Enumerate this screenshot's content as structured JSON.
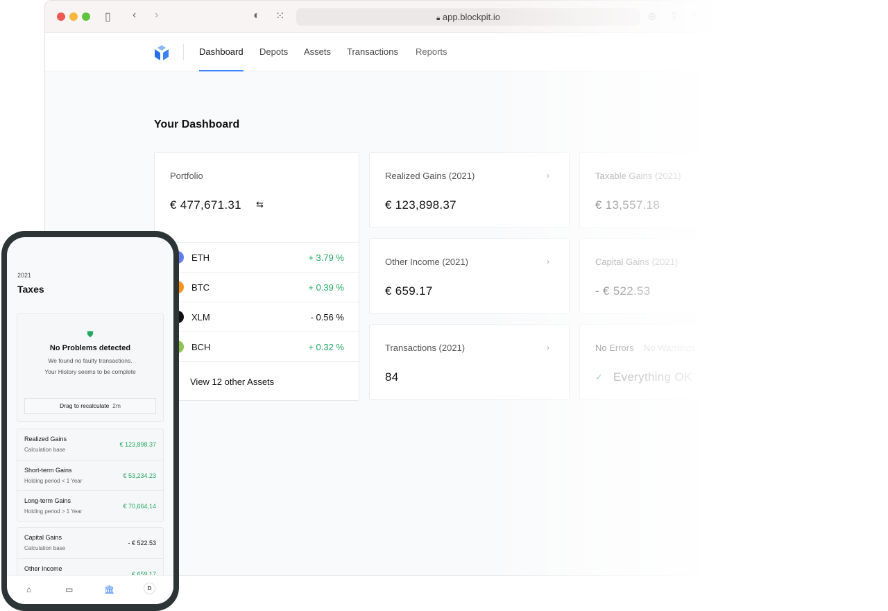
{
  "browser": {
    "url": "app.blockpit.io"
  },
  "nav": {
    "tabs": [
      "Dashboard",
      "Depots",
      "Assets",
      "Transactions",
      "Reports"
    ],
    "active": "Dashboard"
  },
  "page_title": "Your Dashboard",
  "portfolio": {
    "label": "Portfolio",
    "value": "€ 477,671.31",
    "assets": [
      {
        "name": "ETH",
        "change": "+ 3.79 %",
        "color": "#627eea"
      },
      {
        "name": "BTC",
        "change": "+ 0.39 %",
        "color": "#f7931a"
      },
      {
        "name": "XLM",
        "change": "- 0.56 %",
        "color": "#111111"
      },
      {
        "name": "BCH",
        "change": "+ 0.32 %",
        "color": "#8dc351"
      }
    ],
    "more": "View 12 other Assets"
  },
  "cards": {
    "realized": {
      "label": "Realized Gains (2021)",
      "value": "€ 123,898.37"
    },
    "other_income": {
      "label": "Other Income (2021)",
      "value": "€ 659.17"
    },
    "transactions": {
      "label": "Transactions (2021)",
      "value": "84"
    },
    "taxable": {
      "label": "Taxable Gains (2021)",
      "value": "€ 13,557.18"
    },
    "capital": {
      "label": "Capital Gains (2021)",
      "value": "- € 522.53"
    },
    "status": {
      "errors": "No Errors",
      "warnings": "No Warnings",
      "ok": "Everything OK"
    }
  },
  "phone": {
    "year": "2021",
    "title": "Taxes",
    "check": {
      "title": "No Problems detected",
      "line1": "We found no faulty transactions.",
      "line2": "Your History seems to be complete",
      "drag": "Drag to recalculate",
      "time": "2m"
    },
    "gains": [
      {
        "name": "Realized Gains",
        "sub": "Calculation base",
        "value": "€ 123,898.37"
      },
      {
        "name": "Short-term Gains",
        "sub": "Holding period < 1 Year",
        "value": "€ 53,234.23"
      },
      {
        "name": "Long-term Gains",
        "sub": "Holding period > 1 Year",
        "value": "€ 70,664,14"
      }
    ],
    "other": [
      {
        "name": "Capital Gains",
        "sub": "Calculation base",
        "value": "- € 522.53"
      },
      {
        "name": "Other Income",
        "sub": "",
        "value": "€ 659.17"
      }
    ],
    "avatar": "D"
  },
  "colors": {
    "accent": "#3b82f6",
    "positive": "#22a861"
  }
}
